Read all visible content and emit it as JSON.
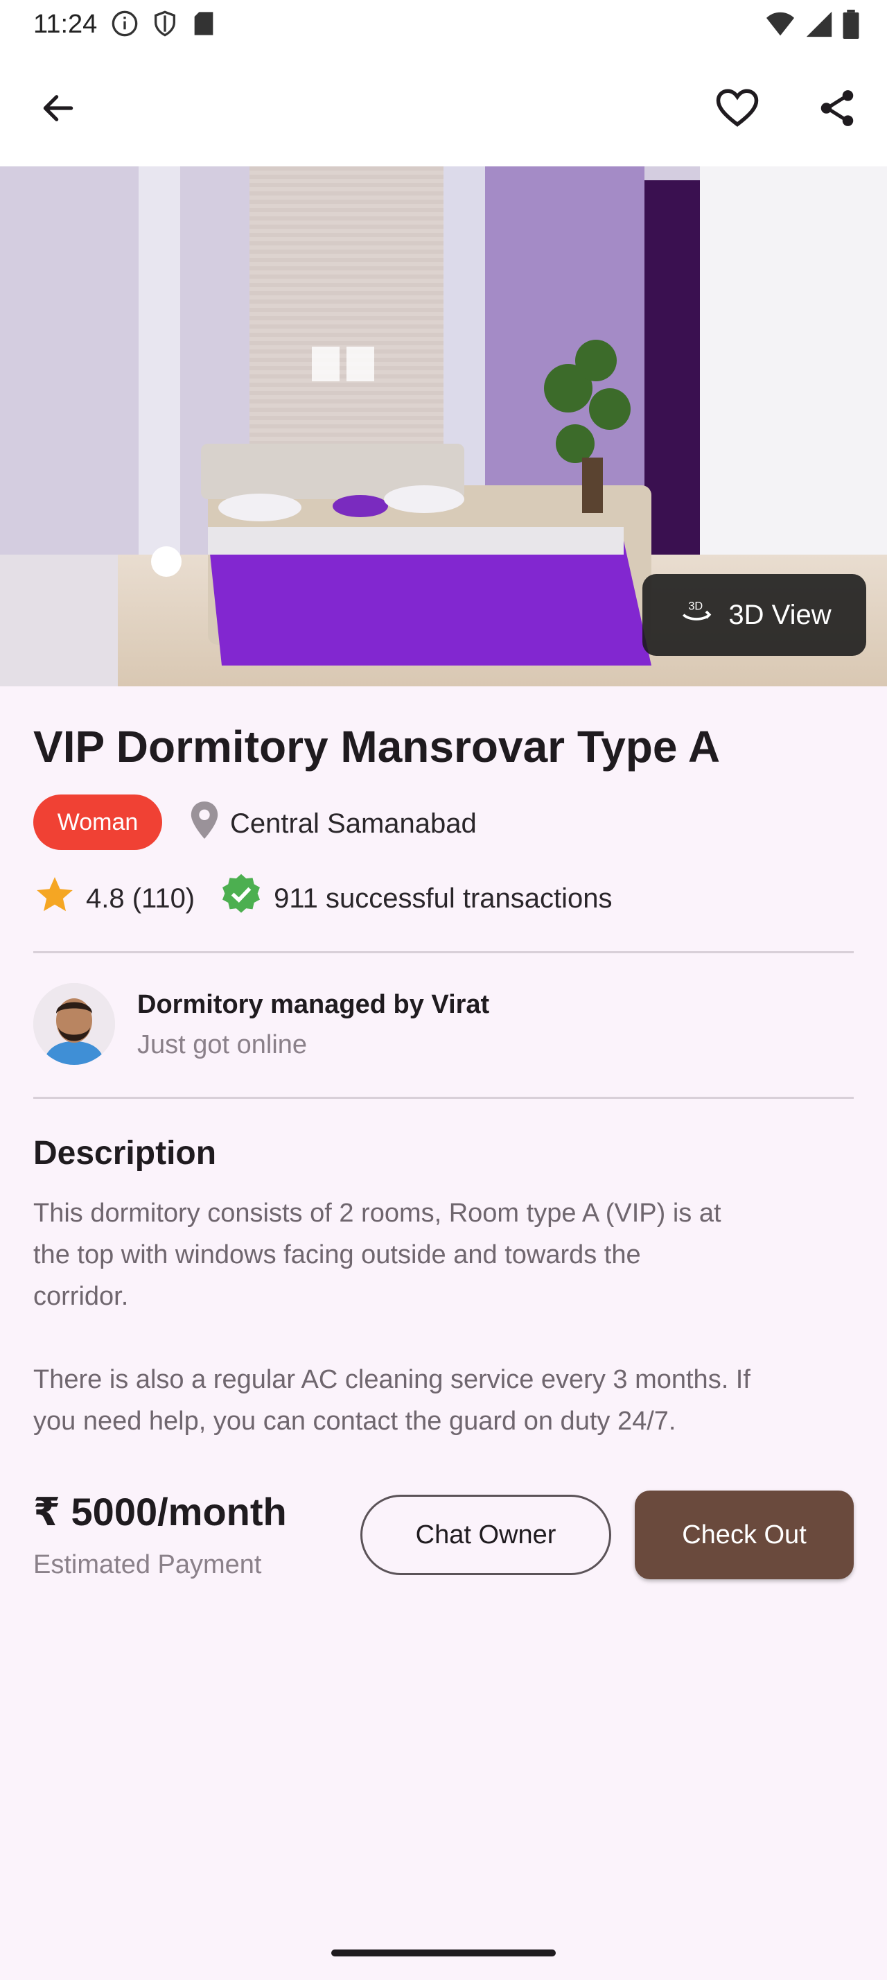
{
  "status_bar": {
    "time": "11:24"
  },
  "listing": {
    "title": "VIP Dormitory Mansrovar Type A",
    "gender_badge": "Woman",
    "location": "Central Samanabad",
    "rating_text": "4.8 (110)",
    "transactions": "911 successful transactions",
    "view_3d_label": "3D View"
  },
  "manager": {
    "name": "Dormitory managed by Virat",
    "status": "Just got online"
  },
  "description": {
    "heading": "Description",
    "paragraph1": "This dormitory consists of 2 rooms, Room type A (VIP) is at\nthe top with windows facing outside and towards the\ncorridor.",
    "paragraph2": "There is also a regular AC cleaning service every 3 months. If\nyou need help, you can contact the guard on duty 24/7."
  },
  "pricing": {
    "price": "₹ 5000/month",
    "subtitle": "Estimated Payment",
    "chat_label": "Chat Owner",
    "checkout_label": "Check Out"
  },
  "colors": {
    "badge": "#f04134",
    "checkout": "#6a4a3d",
    "star": "#f5a623",
    "verified": "#4caf50",
    "background": "#fbf3fb"
  },
  "icons": [
    "info-icon",
    "shield-icon",
    "sd-card-icon",
    "wifi-icon",
    "signal-icon",
    "battery-icon",
    "back-arrow-icon",
    "heart-icon",
    "share-icon",
    "rotate-3d-icon",
    "location-pin-icon",
    "star-icon",
    "verified-badge-icon"
  ]
}
